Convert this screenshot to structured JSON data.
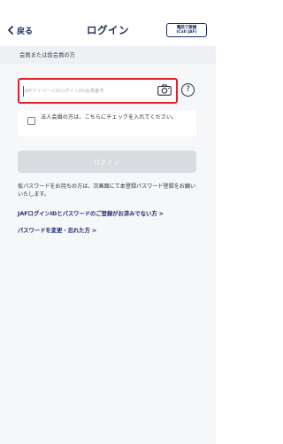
{
  "header": {
    "back_label": "戻る",
    "title": "ログイン",
    "call_button": {
      "line1": "電話で要請",
      "line2": "(Call JAF)"
    }
  },
  "section": {
    "label": "会員または仮会員の方"
  },
  "login_form": {
    "id_input": {
      "value": "",
      "placeholder": "JAFマイページのログインID/会員番号"
    },
    "corporate_checkbox": {
      "checked": false,
      "label": "法人会員の方は、こちらにチェックを入れてください。"
    },
    "login_button_label": "ログイン"
  },
  "notes": {
    "temp_password_note": "仮パスワードをお持ちの方は、次画面にて本登録パスワード登録をお願いいたします。"
  },
  "links": {
    "not_registered": "JAFログインIDとパスワードのご登録がお済みでない方 >",
    "change_password": "パスワードを変更・忘れた方 >"
  },
  "icons": {
    "back": "chevron-left-icon",
    "camera": "camera-icon",
    "help": "help-icon"
  },
  "colors": {
    "primary": "#1e2b6e",
    "highlight": "#e2202a",
    "disabled_button": "#d9dbe0",
    "section_bg": "#eef0f3"
  }
}
